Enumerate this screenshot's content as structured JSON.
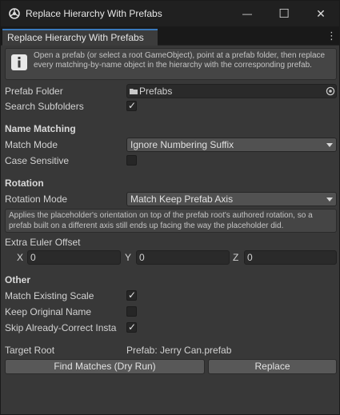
{
  "window": {
    "title": "Replace Hierarchy With Prefabs",
    "tab_label": "Replace Hierarchy With Prefabs",
    "minimize_glyph": "—",
    "maximize_glyph": "☐",
    "close_glyph": "✕",
    "menu_glyph": "⋮"
  },
  "help": {
    "icon": "info-icon",
    "text": "Open a prefab (or select a root GameObject), point at a prefab folder, then replace every matching-by-name object in the hierarchy with the corresponding prefab."
  },
  "fields": {
    "prefab_folder_label": "Prefab Folder",
    "prefab_folder_value": "Prefabs",
    "search_subfolders_label": "Search Subfolders",
    "search_subfolders_checked": true
  },
  "name_matching": {
    "header": "Name Matching",
    "match_mode_label": "Match Mode",
    "match_mode_value": "Ignore Numbering Suffix",
    "case_sensitive_label": "Case Sensitive",
    "case_sensitive_checked": false
  },
  "rotation": {
    "header": "Rotation",
    "mode_label": "Rotation Mode",
    "mode_value": "Match Keep Prefab Axis",
    "help_text": "Applies the placeholder's orientation on top of the prefab root's authored rotation, so a prefab built on a different axis still ends up facing the way the placeholder did.",
    "euler_label": "Extra Euler Offset",
    "x_label": "X",
    "x_value": "0",
    "y_label": "Y",
    "y_value": "0",
    "z_label": "Z",
    "z_value": "0"
  },
  "other": {
    "header": "Other",
    "match_scale_label": "Match Existing Scale",
    "match_scale_checked": true,
    "keep_name_label": "Keep Original Name",
    "keep_name_checked": false,
    "skip_label": "Skip Already-Correct Insta",
    "skip_checked": true
  },
  "target": {
    "label": "Target Root",
    "value": "Prefab: Jerry Can.prefab"
  },
  "buttons": {
    "find_matches": "Find Matches (Dry Run)",
    "replace": "Replace"
  },
  "colors": {
    "window_bg": "#383838",
    "titlebar_bg": "#202020",
    "tab_accent": "#3a79bb",
    "field_bg": "#2a2a2a",
    "button_bg": "#585858"
  }
}
